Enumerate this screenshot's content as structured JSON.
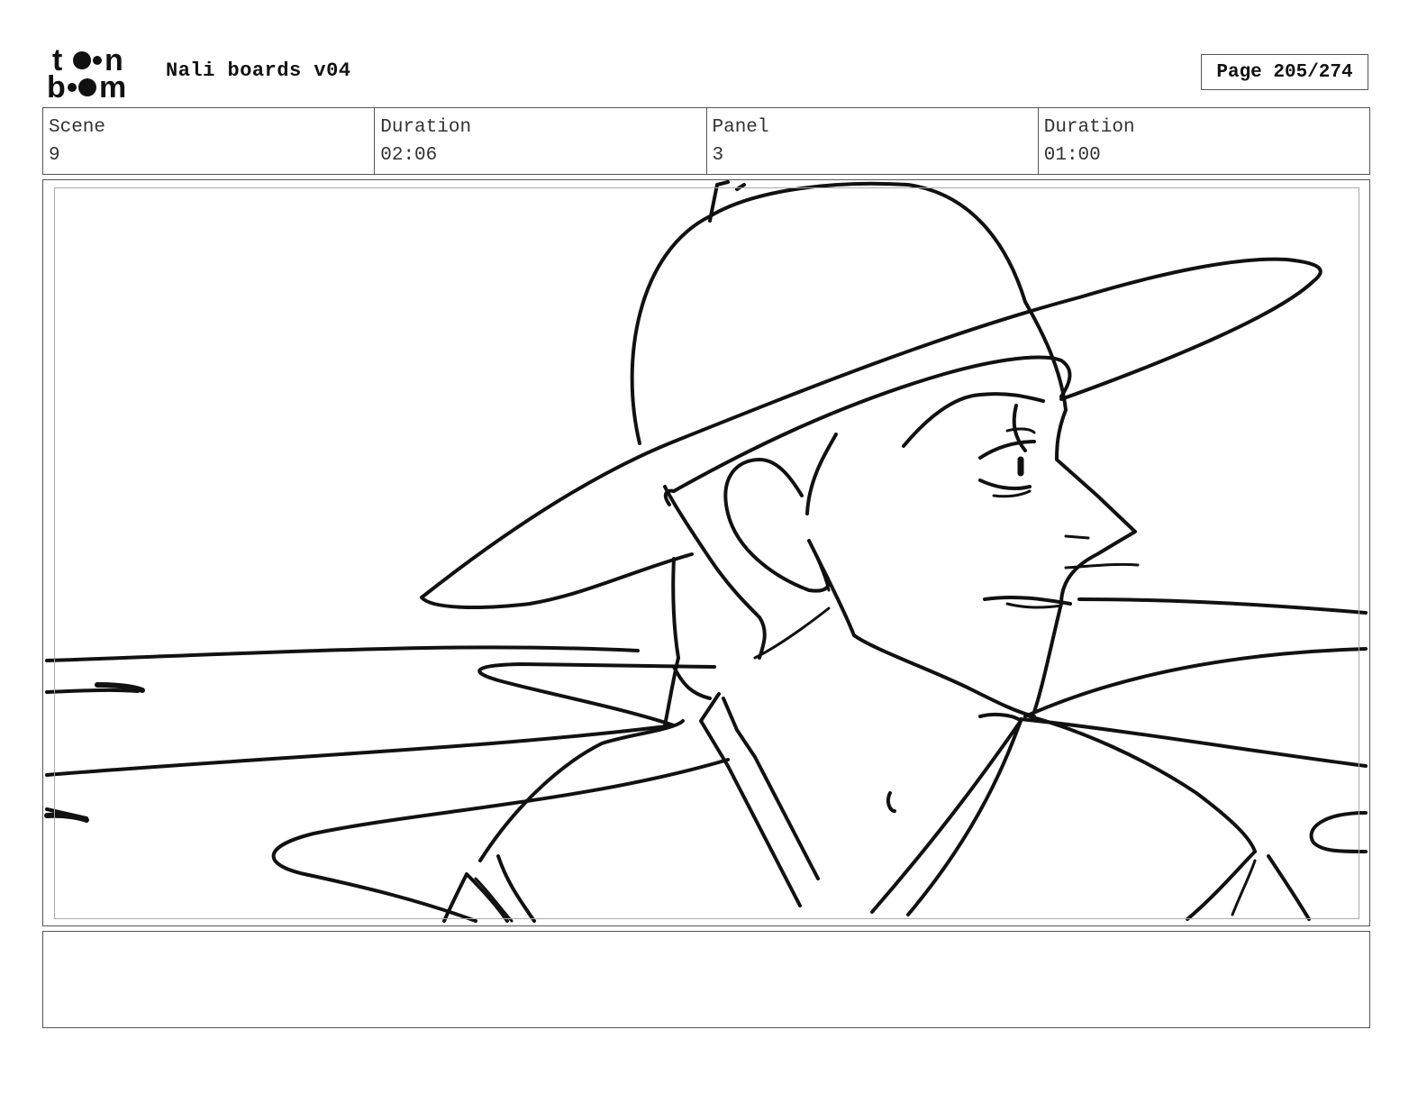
{
  "header": {
    "logo_top": "toon",
    "logo_bottom": "boom",
    "project_title": "Nali boards v04",
    "page_label": "Page 205/274"
  },
  "info": [
    {
      "label": "Scene",
      "value": "9"
    },
    {
      "label": "Duration",
      "value": "02:06"
    },
    {
      "label": "Panel",
      "value": "3"
    },
    {
      "label": "Duration",
      "value": "01:00"
    }
  ],
  "panel": {
    "content": "pencil sketch of a figure in a wide-brimmed hat looking right, flowing lines in background"
  },
  "notes": {
    "text": ""
  }
}
